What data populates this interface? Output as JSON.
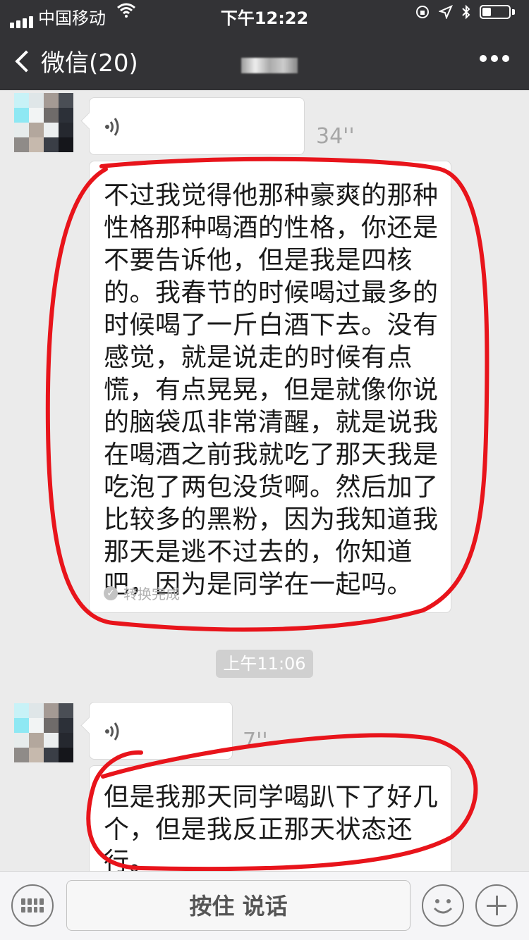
{
  "status_bar": {
    "carrier": "中国移动",
    "time": "下午12:22"
  },
  "nav": {
    "back_label": "微信(20)"
  },
  "messages": [
    {
      "type": "voice",
      "duration": "34''"
    },
    {
      "type": "transcript",
      "text": "不过我觉得他那种豪爽的那种性格那种喝酒的性格，你还是不要告诉他，但是我是四核的。我春节的时候喝过最多的时候喝了一斤白酒下去。没有感觉，就是说走的时候有点慌，有点晃晃，但是就像你说的脑袋瓜非常清醒，就是说我在喝酒之前我就吃了那天我是吃泡了两包没货啊。然后加了比较多的黑粉，因为我知道我那天是逃不过去的，你知道吧，因为是同学在一起吗。",
      "status": "转换完成"
    },
    {
      "type": "timestamp",
      "text": "上午11:06"
    },
    {
      "type": "voice",
      "duration": "7''"
    },
    {
      "type": "transcript",
      "text": "但是我那天同学喝趴下了好几个，但是我反正那天状态还行。"
    }
  ],
  "input_bar": {
    "hold_to_talk": "按住 说话"
  },
  "colors": {
    "header_bg": "#333336",
    "chat_bg": "#ebebeb",
    "annotation_red": "#e8141b"
  },
  "icons": [
    "keyboard-icon",
    "emoji-icon",
    "plus-icon",
    "voice-wave-icon",
    "more-icon",
    "back-chevron-icon",
    "wifi-icon",
    "battery-icon"
  ]
}
